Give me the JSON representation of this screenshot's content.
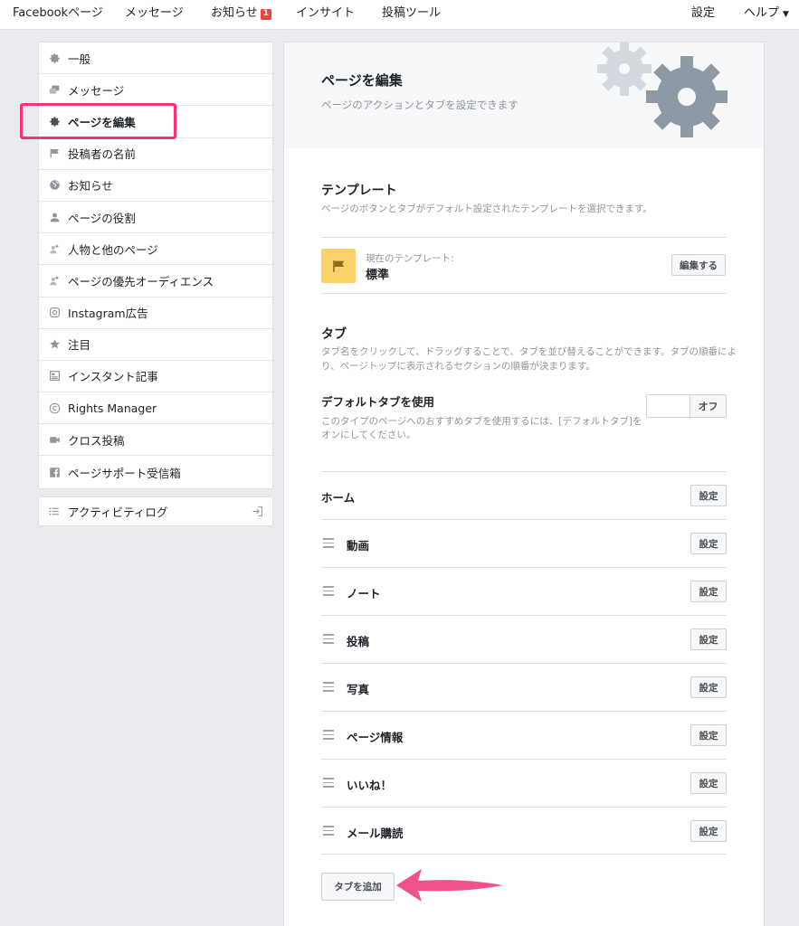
{
  "topnav": {
    "facebook_page": "Facebookページ",
    "messages": "メッセージ",
    "notifications": "お知らせ",
    "notifications_badge": "1",
    "insights": "インサイト",
    "publishing_tools": "投稿ツール",
    "settings": "設定",
    "help": "ヘルプ"
  },
  "sidebar": {
    "items": [
      {
        "label": "一般",
        "icon": "gear-icon"
      },
      {
        "label": "メッセージ",
        "icon": "messages-icon"
      },
      {
        "label": "ページを編集",
        "icon": "gear-icon",
        "active": true
      },
      {
        "label": "投稿者の名前",
        "icon": "flag-icon"
      },
      {
        "label": "お知らせ",
        "icon": "globe-icon"
      },
      {
        "label": "ページの役割",
        "icon": "person-icon"
      },
      {
        "label": "人物と他のページ",
        "icon": "people-icon"
      },
      {
        "label": "ページの優先オーディエンス",
        "icon": "people-icon"
      },
      {
        "label": "Instagram広告",
        "icon": "instagram-icon"
      },
      {
        "label": "注目",
        "icon": "star-icon"
      },
      {
        "label": "インスタント記事",
        "icon": "article-icon"
      },
      {
        "label": "Rights Manager",
        "icon": "copyright-icon"
      },
      {
        "label": "クロス投稿",
        "icon": "video-icon"
      },
      {
        "label": "ページサポート受信箱",
        "icon": "facebook-icon"
      }
    ],
    "activity_log": "アクティビティログ"
  },
  "main": {
    "title": "ページを編集",
    "subtitle": "ページのアクションとタブを設定できます",
    "template": {
      "heading": "テンプレート",
      "description": "ページのボタンとタブがデフォルト設定されたテンプレートを選択できます。",
      "current_label": "現在のテンプレート:",
      "current_name": "標準",
      "edit_button": "編集する"
    },
    "tabs": {
      "heading": "タブ",
      "description_line1": "タブ名をクリックして、ドラッグすることで、タブを並び替えることができます。タブの順番によ",
      "description_line2": "り、ページトップに表示されるセクションの順番が決まります。",
      "default_heading": "デフォルトタブを使用",
      "default_desc_line1": "このタイプのページへのおすすめタブを使用するには、[デフォルトタブ]を",
      "default_desc_line2": "オンにしてください。",
      "toggle_label": "オフ",
      "items": [
        {
          "name": "ホーム",
          "button": "設定",
          "draggable": false
        },
        {
          "name": "動画",
          "button": "設定",
          "draggable": true
        },
        {
          "name": "ノート",
          "button": "設定",
          "draggable": true
        },
        {
          "name": "投稿",
          "button": "設定",
          "draggable": true
        },
        {
          "name": "写真",
          "button": "設定",
          "draggable": true
        },
        {
          "name": "ページ情報",
          "button": "設定",
          "draggable": true
        },
        {
          "name": "いいね！",
          "button": "設定",
          "draggable": true
        },
        {
          "name": "メール購読",
          "button": "設定",
          "draggable": true
        }
      ],
      "add_button": "タブを追加"
    }
  },
  "colors": {
    "highlight": "#ff2f7a",
    "badge": "#fa3e3e",
    "template_icon_bg": "#fbd26a",
    "gear_light": "#d3d9df",
    "gear_dark": "#8d9aa6"
  }
}
